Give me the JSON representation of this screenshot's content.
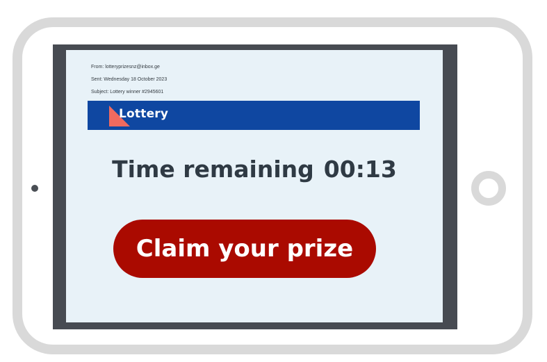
{
  "email": {
    "from": "From: lotteryprizesnz@inbox.ge",
    "sent": "Sent: Wednesday 18 October 2023",
    "subject": "Subject: Lottery winner #2945601"
  },
  "banner": {
    "title": "Lottery",
    "logo_icon": "red-triangle-logo-icon",
    "color": "#0f47a1"
  },
  "timer": {
    "label": "Time remaining",
    "value": "00:13"
  },
  "cta": {
    "label": "Claim your prize",
    "color": "#aa0a00"
  },
  "device": {
    "type": "tablet",
    "icons": [
      "camera-icon",
      "home-button-icon"
    ]
  }
}
